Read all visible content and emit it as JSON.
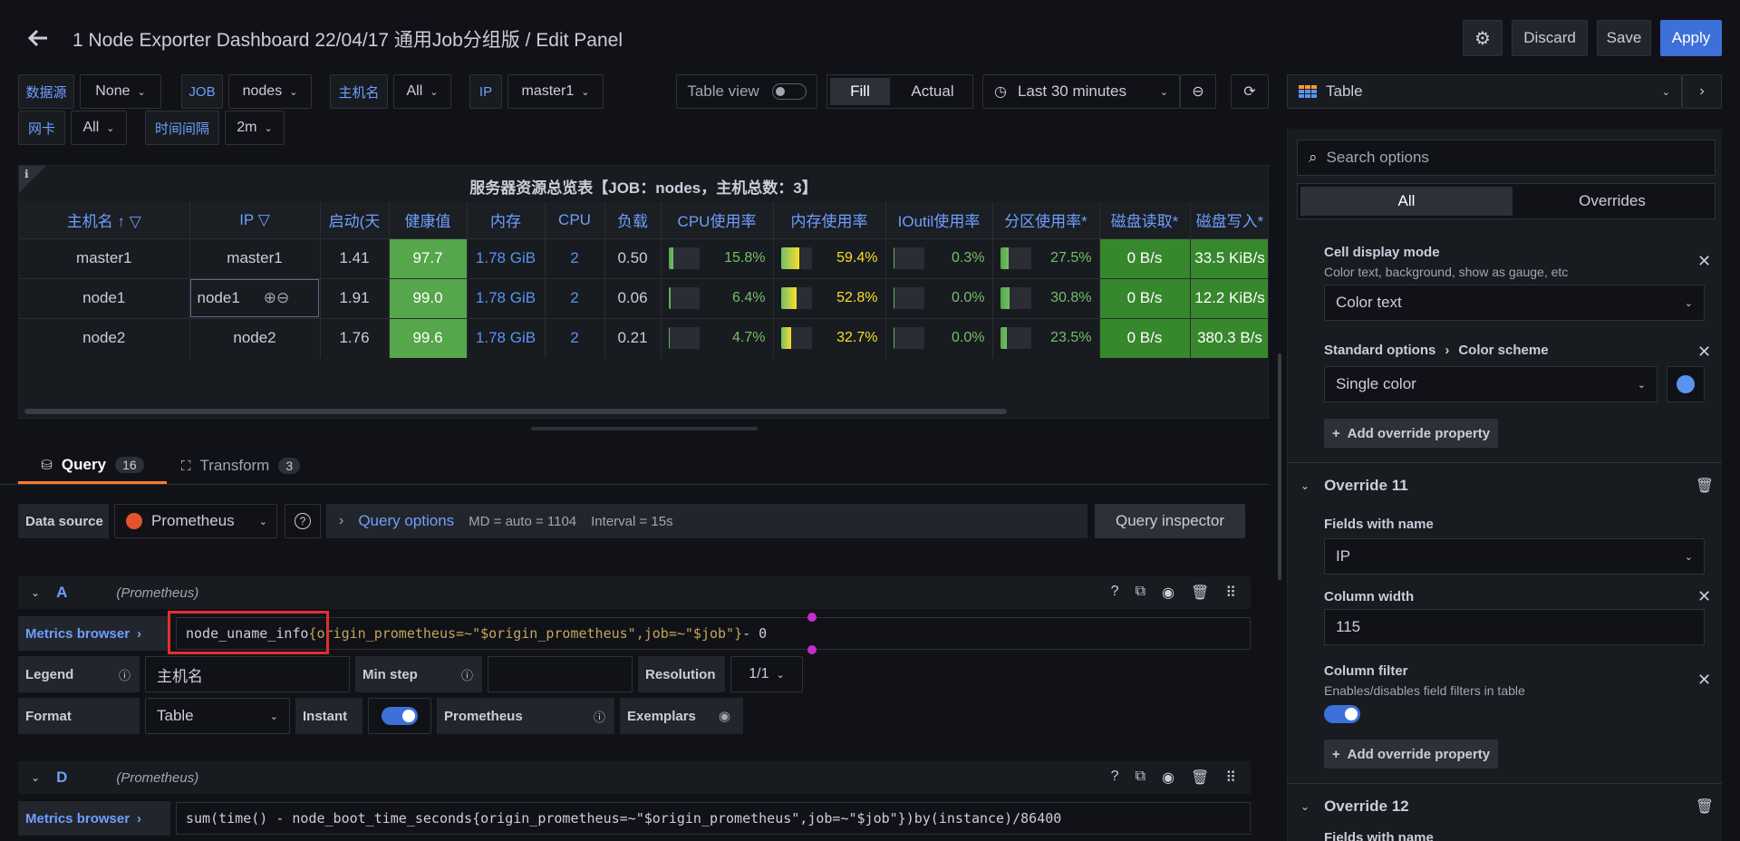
{
  "header": {
    "title": "1 Node Exporter Dashboard 22/04/17 通用Job分组版 / Edit Panel",
    "discard": "Discard",
    "save": "Save",
    "apply": "Apply"
  },
  "vars": [
    {
      "label": "数据源",
      "value": "None"
    },
    {
      "label": "JOB",
      "value": "nodes"
    },
    {
      "label": "主机名",
      "value": "All"
    },
    {
      "label": "IP",
      "value": "master1"
    },
    {
      "label": "网卡",
      "value": "All"
    },
    {
      "label": "时间间隔",
      "value": "2m"
    }
  ],
  "toolbar": {
    "table_view": "Table view",
    "fill": "Fill",
    "actual": "Actual",
    "time_range": "Last 30 minutes",
    "viz": "Table"
  },
  "table": {
    "title": "服务器资源总览表【JOB：nodes，主机总数：3】",
    "columns": [
      "主机名",
      "IP",
      "启动(天",
      "健康值",
      "内存",
      "CPU",
      "负载",
      "CPU使用率",
      "内存使用率",
      "IOutil使用率",
      "分区使用率*",
      "磁盘读取*",
      "磁盘写入*"
    ],
    "sort_arrow": "↑",
    "rows": [
      {
        "host": "master1",
        "ip": "master1",
        "uptime": "1.41",
        "health": "97.7",
        "mem": "1.78 GiB",
        "cpu": "2",
        "load": "0.50",
        "cpu_pct": "15.8%",
        "cpu_frac": 0.158,
        "mem_pct": "59.4%",
        "mem_frac": 0.594,
        "io_pct": "0.3%",
        "io_frac": 0.003,
        "part_pct": "27.5%",
        "part_frac": 0.275,
        "read": "0 B/s",
        "write": "33.5 KiB/s"
      },
      {
        "host": "node1",
        "ip": "node1",
        "uptime": "1.91",
        "health": "99.0",
        "mem": "1.78 GiB",
        "cpu": "2",
        "load": "0.06",
        "cpu_pct": "6.4%",
        "cpu_frac": 0.064,
        "mem_pct": "52.8%",
        "mem_frac": 0.528,
        "io_pct": "0.0%",
        "io_frac": 0.0,
        "part_pct": "30.8%",
        "part_frac": 0.308,
        "read": "0 B/s",
        "write": "12.2 KiB/s"
      },
      {
        "host": "node2",
        "ip": "node2",
        "uptime": "1.76",
        "health": "99.6",
        "mem": "1.78 GiB",
        "cpu": "2",
        "load": "0.21",
        "cpu_pct": "4.7%",
        "cpu_frac": 0.047,
        "mem_pct": "32.7%",
        "mem_frac": 0.327,
        "io_pct": "0.0%",
        "io_frac": 0.0,
        "part_pct": "23.5%",
        "part_frac": 0.235,
        "read": "0 B/s",
        "write": "380.3 B/s"
      }
    ]
  },
  "tabs": {
    "query": "Query",
    "query_count": "16",
    "transform": "Transform",
    "transform_count": "3"
  },
  "datasource": {
    "label": "Data source",
    "value": "Prometheus",
    "query_options": "Query options",
    "md": "MD = auto = 1104",
    "interval": "Interval = 15s",
    "inspector": "Query inspector"
  },
  "queryA": {
    "letter": "A",
    "ds": "(Prometheus)",
    "metrics_browser": "Metrics browser",
    "metric": "node_uname_info",
    "selector": "{origin_prometheus=~\"$origin_prometheus\",job=~\"$job\"}",
    "suffix": " - 0",
    "legend_label": "Legend",
    "legend_value": "主机名",
    "minstep_label": "Min step",
    "resolution_label": "Resolution",
    "resolution_value": "1/1",
    "format_label": "Format",
    "format_value": "Table",
    "instant_label": "Instant",
    "prometheus_label": "Prometheus",
    "exemplars_label": "Exemplars"
  },
  "queryD": {
    "letter": "D",
    "ds": "(Prometheus)",
    "metrics_browser": "Metrics browser",
    "expr": "sum(time() - node_boot_time_seconds{origin_prometheus=~\"$origin_prometheus\",job=~\"$job\"})by(instance)/86400"
  },
  "options": {
    "search_placeholder": "Search options",
    "all": "All",
    "overrides": "Overrides",
    "cell_display_title": "Cell display mode",
    "cell_display_desc": "Color text, background, show as gauge, etc",
    "cell_display_value": "Color text",
    "std_options": "Standard options",
    "color_scheme": "Color scheme",
    "color_scheme_value": "Single color",
    "color_swatch": "#5794f2",
    "add_override": "Add override property",
    "override11": "Override 11",
    "fields_with_name": "Fields with name",
    "fields_value": "IP",
    "column_width": "Column width",
    "column_width_value": "115",
    "column_filter": "Column filter",
    "column_filter_desc": "Enables/disables field filters in table",
    "add_override2": "Add override property",
    "override12": "Override 12",
    "fields_with_name2": "Fields with name"
  }
}
